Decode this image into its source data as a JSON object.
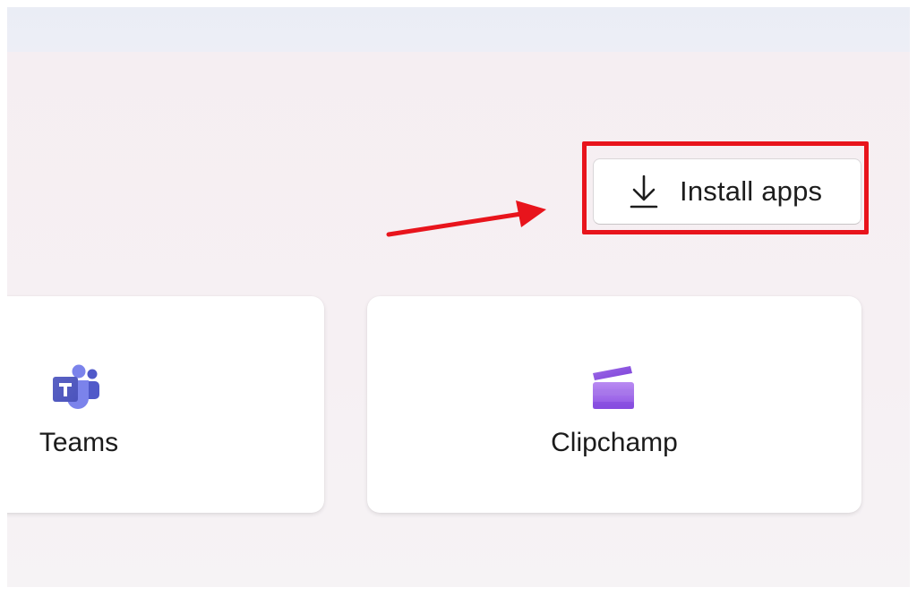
{
  "toolbar": {
    "install_label": "Install apps",
    "install_icon": "download-icon"
  },
  "annotation": {
    "highlight_color": "#e8141c",
    "arrow_color": "#e8141c"
  },
  "apps": [
    {
      "name": "Teams",
      "icon": "teams-icon"
    },
    {
      "name": "Clipchamp",
      "icon": "clipchamp-icon"
    }
  ]
}
